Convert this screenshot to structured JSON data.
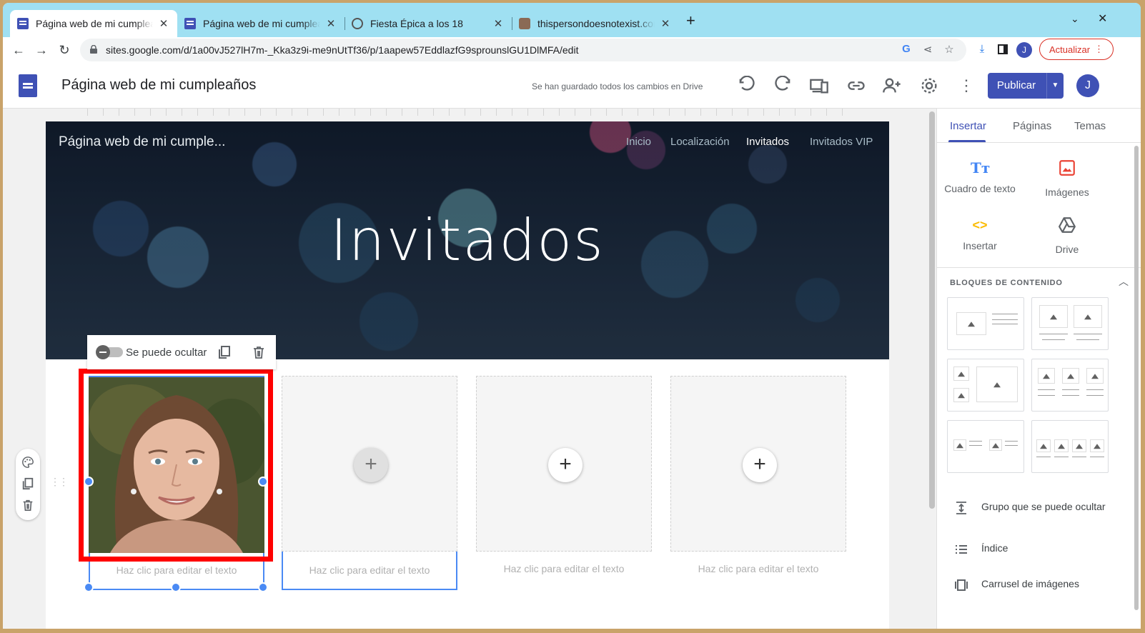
{
  "browser": {
    "tabs": [
      {
        "title": "Página web de mi cumpleaños",
        "favicon": "google-sites-icon",
        "active": true
      },
      {
        "title": "Página web de mi cumpleaños",
        "favicon": "google-sites-icon",
        "active": false
      },
      {
        "title": "Fiesta Épica a los 18",
        "favicon": "chatgpt-icon",
        "active": false
      },
      {
        "title": "thispersondoesnotexist.com",
        "favicon": "face-photo-icon",
        "active": false
      }
    ],
    "url": "sites.google.com/d/1a00vJ527lH7m-_Kka3z9i-me9nUtTf36/p/1aapew57EddlazfG9sprounslGU1DlMFA/edit",
    "profile_initial": "J",
    "update_label": "Actualizar"
  },
  "editor": {
    "doc_title": "Página web de mi cumpleaños",
    "save_status": "Se han guardado todos los cambios en Drive",
    "publish_label": "Publicar",
    "avatar_initial": "J"
  },
  "site": {
    "name": "Página web de mi cumple...",
    "nav": [
      {
        "label": "Inicio",
        "active": false
      },
      {
        "label": "Localización",
        "active": false
      },
      {
        "label": "Invitados",
        "active": true
      },
      {
        "label": "Invitados VIP",
        "active": false
      }
    ],
    "hero_title": "Invitados",
    "group_toolbar": {
      "hide_label": "Se puede ocultar"
    },
    "cards": [
      {
        "caption": "Haz clic para editar el texto",
        "has_image": true
      },
      {
        "caption": "Haz clic para editar el texto",
        "has_image": false
      },
      {
        "caption": "Haz clic para editar el texto",
        "has_image": false
      },
      {
        "caption": "Haz clic para editar el texto",
        "has_image": false
      }
    ]
  },
  "panel": {
    "tabs": [
      "Insertar",
      "Páginas",
      "Temas"
    ],
    "active_tab": "Insertar",
    "insert_items": [
      {
        "label": "Cuadro de texto",
        "icon": "text-box-icon",
        "color": "#4285f4"
      },
      {
        "label": "Imágenes",
        "icon": "image-icon",
        "color": "#ea4335"
      },
      {
        "label": "Insertar",
        "icon": "embed-code-icon",
        "color": "#fbbc04"
      },
      {
        "label": "Drive",
        "icon": "drive-icon",
        "color": "#5f6368"
      }
    ],
    "blocks_title": "BLOQUES DE CONTENIDO",
    "list_items": [
      {
        "label": "Grupo que se puede ocultar",
        "icon": "collapsible-group-icon"
      },
      {
        "label": "Índice",
        "icon": "table-of-contents-icon"
      },
      {
        "label": "Carrusel de imágenes",
        "icon": "image-carousel-icon"
      }
    ]
  },
  "colors": {
    "accent": "#3f51b5",
    "selection": "#4a8af4",
    "highlight": "#ff0000"
  }
}
